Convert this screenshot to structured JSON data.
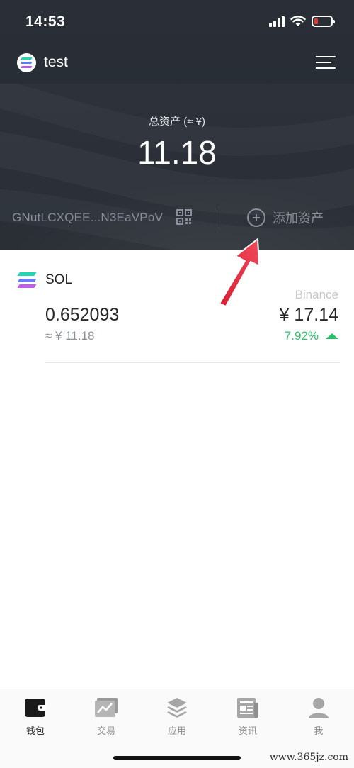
{
  "status_bar": {
    "time": "14:53"
  },
  "wallet": {
    "name": "test"
  },
  "summary": {
    "total_label": "总资产 (≈ ¥)",
    "total_value": "11.18",
    "address": "GNutLCXQEE...N3EaVPoV",
    "add_asset_label": "添加资产"
  },
  "assets": [
    {
      "symbol": "SOL",
      "exchange": "Binance",
      "amount": "0.652093",
      "fiat_value": "≈ ¥ 11.18",
      "price": "¥ 17.14",
      "change": "7.92%",
      "change_direction": "up"
    }
  ],
  "tab_bar": {
    "tabs": [
      {
        "label": "钱包",
        "icon": "wallet-icon",
        "active": true
      },
      {
        "label": "交易",
        "icon": "trade-chart-icon",
        "active": false
      },
      {
        "label": "应用",
        "icon": "layers-icon",
        "active": false
      },
      {
        "label": "资讯",
        "icon": "newspaper-icon",
        "active": false
      },
      {
        "label": "我",
        "icon": "user-icon",
        "active": false
      }
    ]
  },
  "watermark": "www.365jz.com",
  "colors": {
    "header_bg": "#2a2f37",
    "positive": "#2bc36b",
    "annotation_arrow": "#e8283c",
    "solana_gradient": [
      "#19e6b5",
      "#7b5cf0",
      "#c95be8"
    ]
  }
}
